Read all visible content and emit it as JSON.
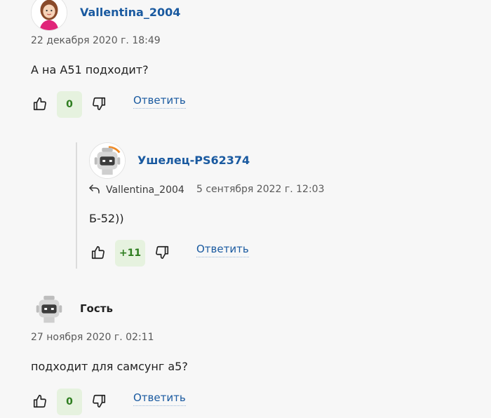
{
  "comments": [
    {
      "author": "Vallentina_2004",
      "date": "22 декабря 2020 г. 18:49",
      "text": "А на А51 подходит?",
      "score": "0",
      "reply_label": "Ответить"
    },
    {
      "author": "Ушелец-PS62374",
      "reply_to": "Vallentina_2004",
      "date": "5 сентября 2022 г. 12:03",
      "text": "Б-52))",
      "score": "+11",
      "reply_label": "Ответить"
    },
    {
      "author": "Гость",
      "date": "27 ноября 2020 г. 02:11",
      "text": "подходит для самсунг а5?",
      "score": "0",
      "reply_label": "Ответить"
    }
  ],
  "colors": {
    "link": "#1a5aa0",
    "score_bg": "#e6f2df",
    "score_text": "#2e7d1f",
    "page_bg": "#f7f7f7"
  },
  "icons": {
    "like": "thumbs-up-icon",
    "dislike": "thumbs-down-icon",
    "reply_arrow": "reply-arrow-icon"
  }
}
